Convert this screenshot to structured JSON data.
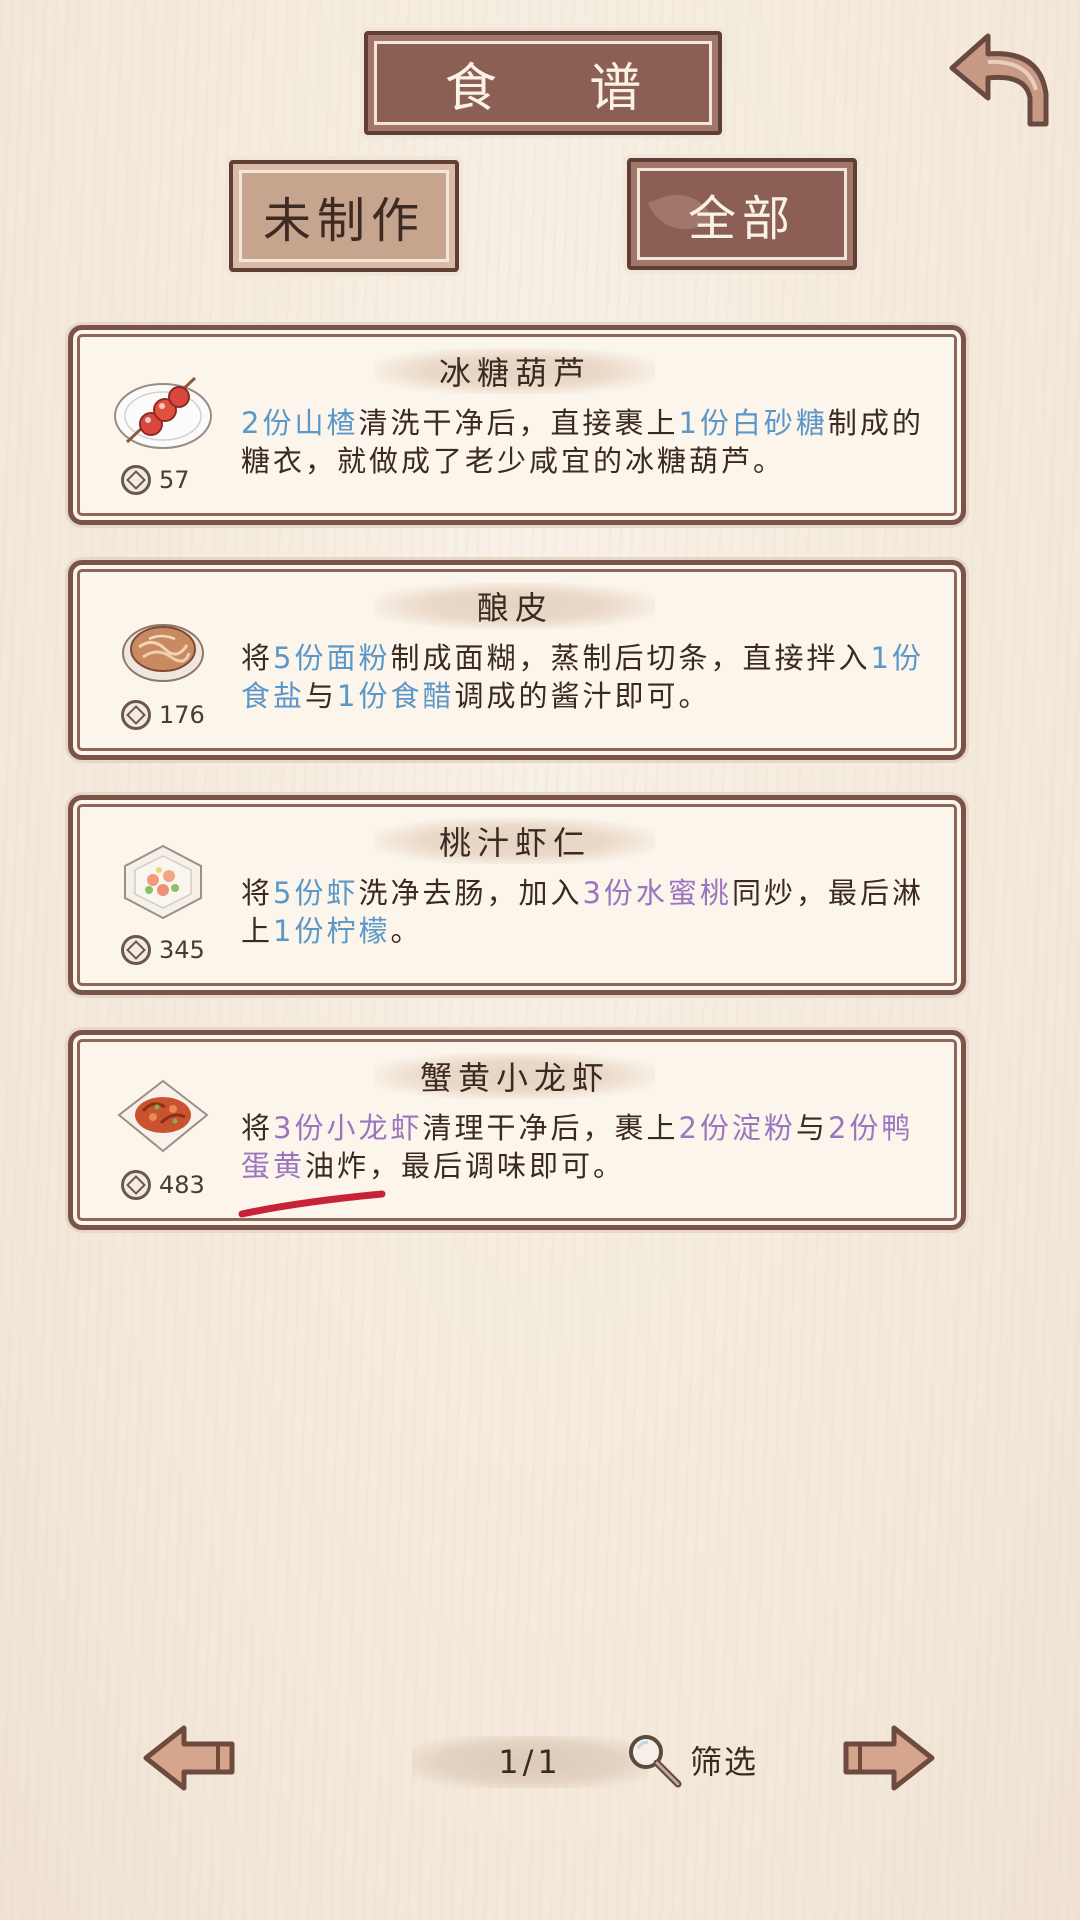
{
  "header": {
    "title": "食 谱"
  },
  "tabs": [
    {
      "label": "未制作"
    },
    {
      "label": "全部"
    }
  ],
  "recipes": [
    {
      "name": "冰糖葫芦",
      "price": "57",
      "desc": [
        {
          "t": "2份山楂",
          "c": "blue"
        },
        {
          "t": "清洗干净后，直接裹上",
          "c": ""
        },
        {
          "t": "1份白砂糖",
          "c": "blue"
        },
        {
          "t": "制成的糖衣，就做成了老少咸宜的冰糖葫芦。",
          "c": ""
        }
      ]
    },
    {
      "name": "酿皮",
      "price": "176",
      "desc": [
        {
          "t": "将",
          "c": ""
        },
        {
          "t": "5份面粉",
          "c": "blue"
        },
        {
          "t": "制成面糊，蒸制后切条，直接拌入",
          "c": ""
        },
        {
          "t": "1份食盐",
          "c": "blue"
        },
        {
          "t": "与",
          "c": ""
        },
        {
          "t": "1份食醋",
          "c": "blue"
        },
        {
          "t": "调成的酱汁即可。",
          "c": ""
        }
      ]
    },
    {
      "name": "桃汁虾仁",
      "price": "345",
      "desc": [
        {
          "t": "将",
          "c": ""
        },
        {
          "t": "5份虾",
          "c": "blue"
        },
        {
          "t": "洗净去肠，加入",
          "c": ""
        },
        {
          "t": "3份水蜜桃",
          "c": "purple"
        },
        {
          "t": "同炒，最后淋上",
          "c": ""
        },
        {
          "t": "1份柠檬",
          "c": "blue"
        },
        {
          "t": "。",
          "c": ""
        }
      ]
    },
    {
      "name": "蟹黄小龙虾",
      "price": "483",
      "desc": [
        {
          "t": "将",
          "c": ""
        },
        {
          "t": "3份小龙虾",
          "c": "purple"
        },
        {
          "t": "清理干净后，裹上",
          "c": ""
        },
        {
          "t": "2份淀粉",
          "c": "purple"
        },
        {
          "t": "与",
          "c": ""
        },
        {
          "t": "2份鸭蛋黄",
          "c": "purple"
        },
        {
          "t": "油炸，最后调味即可。",
          "c": ""
        }
      ]
    }
  ],
  "pagination": {
    "page": "1/1",
    "filter_label": "筛选"
  },
  "colors": {
    "highlight_blue": "#5b97c7",
    "highlight_purple": "#9b76c0",
    "plaque": "#8c5f55",
    "annotation_red": "#c8223a"
  },
  "icons": [
    "back-arrow-icon",
    "coin-icon",
    "prev-arrow-icon",
    "next-arrow-icon",
    "magnifier-icon"
  ]
}
